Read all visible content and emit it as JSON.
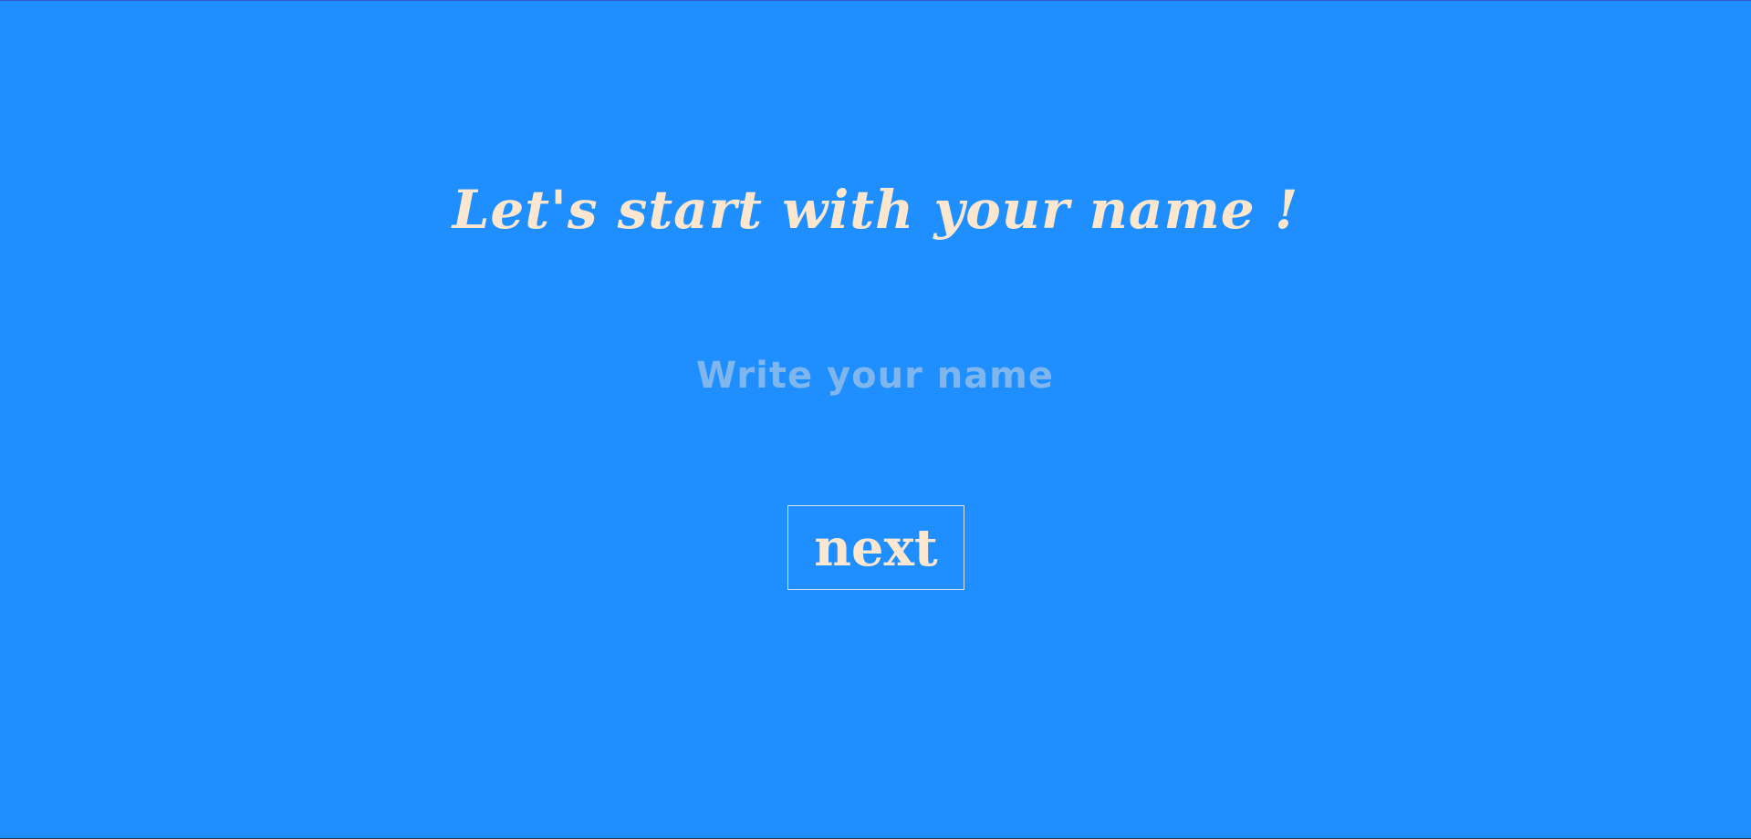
{
  "page": {
    "heading": "Let's start with your name !",
    "name_input": {
      "value": "",
      "placeholder": "Write your name"
    },
    "next_button_label": "next"
  },
  "colors": {
    "background": "#1f8fff",
    "text": "#fbe7cf",
    "placeholder": "#7fb6ee",
    "button_border": "#d8e2ee"
  }
}
